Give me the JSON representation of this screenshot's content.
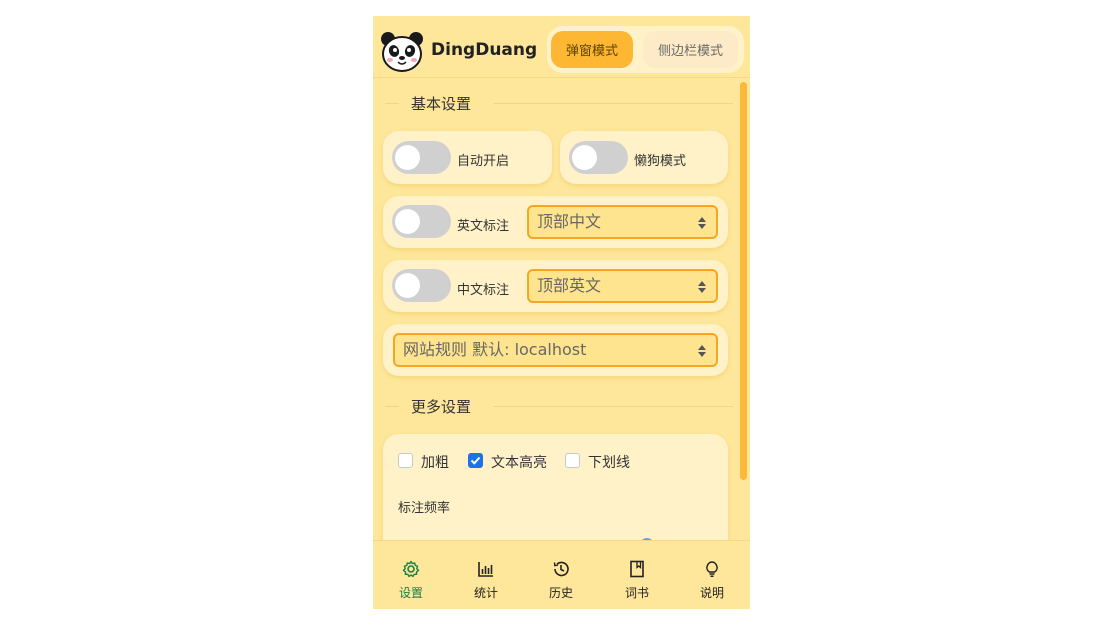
{
  "header": {
    "app_title": "DingDuang",
    "modes": [
      "弹窗模式",
      "侧边栏模式"
    ],
    "active_mode": "弹窗模式"
  },
  "sections": {
    "basic_title": "基本设置",
    "more_title": "更多设置"
  },
  "basic": {
    "auto_open_label": "自动开启",
    "lazy_mode_label": "懒狗模式",
    "english_annot_label": "英文标注",
    "english_annot_select": "顶部中文",
    "chinese_annot_label": "中文标注",
    "chinese_annot_select": "顶部英文",
    "site_rule_select": "网站规则 默认: localhost"
  },
  "more": {
    "bold_label": "加粗",
    "highlight_label": "文本高亮",
    "underline_label": "下划线",
    "freq_label": "标注频率"
  },
  "nav": {
    "items": [
      "设置",
      "统计",
      "历史",
      "词书",
      "说明"
    ],
    "active": "设置"
  },
  "colors": {
    "panel_bg": "#fee79a",
    "accent": "#fdb732",
    "active_nav": "#1b7f4a",
    "checkbox_checked": "#1a73e8"
  }
}
